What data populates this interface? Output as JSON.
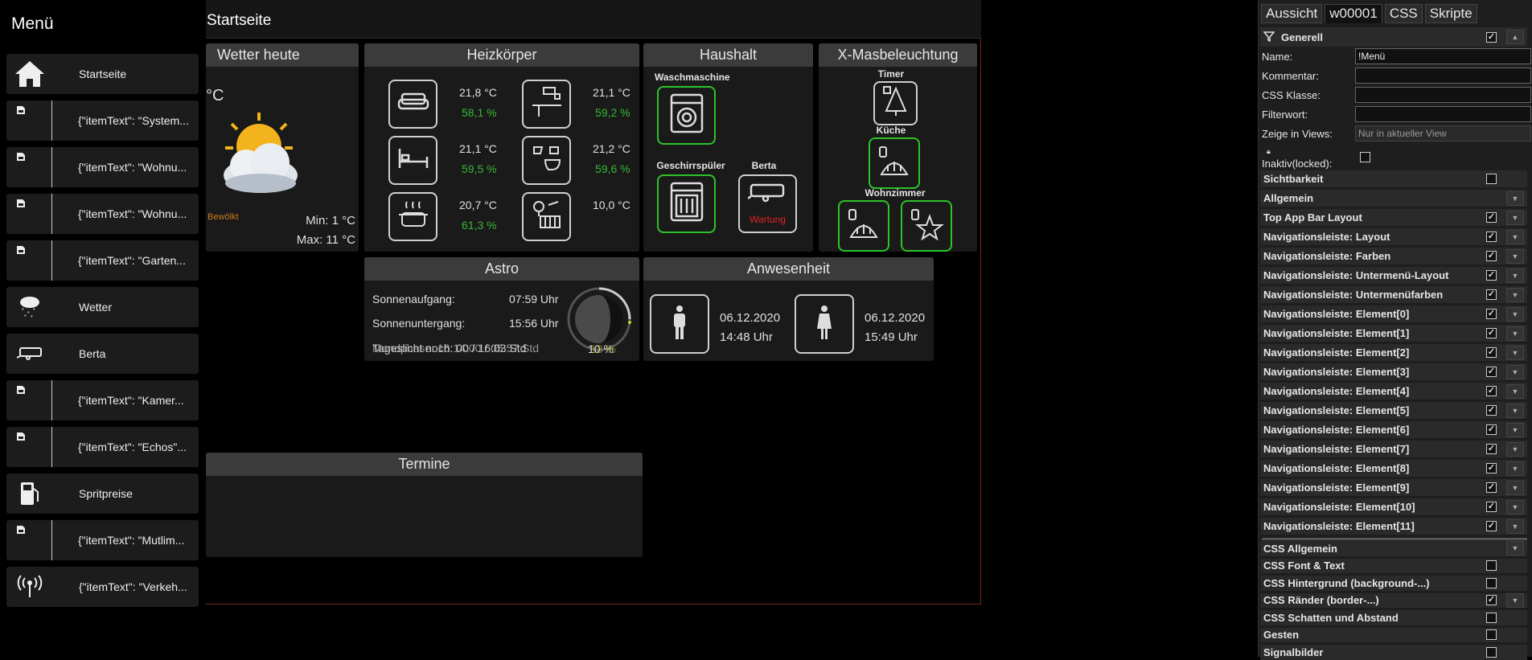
{
  "sidebar": {
    "title": "Menü",
    "items": [
      {
        "label": "Startseite",
        "icon": "home-icon"
      },
      {
        "label": "{\"itemText\": \"System...",
        "icon": "broken-image-icon"
      },
      {
        "label": "{\"itemText\": \"Wohnu...",
        "icon": "broken-image-icon"
      },
      {
        "label": "{\"itemText\": \"Wohnu...",
        "icon": "broken-image-icon"
      },
      {
        "label": "{\"itemText\": \"Garten...",
        "icon": "broken-image-icon"
      },
      {
        "label": "Wetter",
        "icon": "weather-snow-icon"
      },
      {
        "label": "Berta",
        "icon": "caravan-icon"
      },
      {
        "label": "{\"itemText\": \"Kamer...",
        "icon": "broken-image-icon"
      },
      {
        "label": "{\"itemText\": \"Echos\"...",
        "icon": "broken-image-icon"
      },
      {
        "label": "Spritpreise",
        "icon": "fuel-pump-icon"
      },
      {
        "label": "{\"itemText\": \"Mutlim...",
        "icon": "broken-image-icon"
      },
      {
        "label": "{\"itemText\": \"Verkeh...",
        "icon": "antenna-icon"
      }
    ]
  },
  "topbar": {
    "title": "Startseite"
  },
  "weather": {
    "title": "Wetter heute",
    "unit": "°C",
    "condition": "Bewölkt",
    "min": "Min: 1 °C",
    "max": "Max: 11 °C"
  },
  "heating": {
    "title": "Heizkörper",
    "rooms": [
      {
        "icon": "sofa-icon",
        "temp": "21,8 °C",
        "hum": "58,1 %"
      },
      {
        "icon": "kitchen-icon",
        "temp": "21,1 °C",
        "hum": "59,2 %"
      },
      {
        "icon": "bed-icon",
        "temp": "21,1 °C",
        "hum": "59,5 %"
      },
      {
        "icon": "bathroom-icon",
        "temp": "21,2 °C",
        "hum": "59,6 %"
      },
      {
        "icon": "cooking-pot-icon",
        "temp": "20,7 °C",
        "hum": "61,3 %"
      },
      {
        "icon": "radiator-icon",
        "temp": "10,0 °C",
        "hum": ""
      }
    ]
  },
  "household": {
    "title": "Haushalt",
    "washer": "Waschmaschine",
    "dishwasher": "Geschirrspüler",
    "caravan": "Berta",
    "caravan_status": "Wartung"
  },
  "xmas": {
    "title": "X-Masbeleuchtung",
    "timer": "Timer",
    "kitchen": "Küche",
    "living": "Wohnzimmer"
  },
  "astro": {
    "title": "Astro",
    "sunrise_label": "Sonnenaufgang:",
    "sunrise": "07:59 Uhr",
    "sunset_label": "Sonnenuntergang:",
    "sunset": "15:56 Uhr",
    "overlap_left": "Tageslicht noch: 00 / 16:03 Std",
    "overlap_right": "Mondphase: 16:14:00 / 05:57 Std",
    "moon_percent": "10 %",
    "moon_overlap": "13 %"
  },
  "presence": {
    "title": "Anwesenheit",
    "persons": [
      {
        "icon": "man-icon",
        "date": "06.12.2020",
        "time": "14:48 Uhr"
      },
      {
        "icon": "woman-icon",
        "date": "06.12.2020",
        "time": "15:49 Uhr"
      }
    ]
  },
  "appointments": {
    "title": "Termine"
  },
  "editor": {
    "tabs": [
      "Aussicht",
      "w00001",
      "CSS",
      "Skripte"
    ],
    "group_general": "Generell",
    "name_label": "Name:",
    "name_value": "!Menü",
    "comment_label": "Kommentar:",
    "css_class_label": "CSS Klasse:",
    "filter_label": "Filterwort:",
    "views_label": "Zeige in Views:",
    "views_value": "Nur in aktueller View",
    "locked_label": "Inaktiv(locked):",
    "groups": [
      {
        "label": "Sichtbarkeit",
        "checked": false,
        "arrow": false
      },
      {
        "label": "Allgemein",
        "checked": null,
        "arrow": true
      },
      {
        "label": "Top App Bar Layout",
        "checked": true,
        "arrow": true
      },
      {
        "label": "Navigationsleiste: Layout",
        "checked": true,
        "arrow": true
      },
      {
        "label": "Navigationsleiste: Farben",
        "checked": true,
        "arrow": true
      },
      {
        "label": "Navigationsleiste: Untermenü-Layout",
        "checked": true,
        "arrow": true
      },
      {
        "label": "Navigationsleiste: Untermenüfarben",
        "checked": true,
        "arrow": true
      },
      {
        "label": "Navigationsleiste: Element[0]",
        "checked": true,
        "arrow": true
      },
      {
        "label": "Navigationsleiste: Element[1]",
        "checked": true,
        "arrow": true
      },
      {
        "label": "Navigationsleiste: Element[2]",
        "checked": true,
        "arrow": true
      },
      {
        "label": "Navigationsleiste: Element[3]",
        "checked": true,
        "arrow": true
      },
      {
        "label": "Navigationsleiste: Element[4]",
        "checked": true,
        "arrow": true
      },
      {
        "label": "Navigationsleiste: Element[5]",
        "checked": true,
        "arrow": true
      },
      {
        "label": "Navigationsleiste: Element[6]",
        "checked": true,
        "arrow": true
      },
      {
        "label": "Navigationsleiste: Element[7]",
        "checked": true,
        "arrow": true
      },
      {
        "label": "Navigationsleiste: Element[8]",
        "checked": true,
        "arrow": true
      },
      {
        "label": "Navigationsleiste: Element[9]",
        "checked": true,
        "arrow": true
      },
      {
        "label": "Navigationsleiste: Element[10]",
        "checked": true,
        "arrow": true
      },
      {
        "label": "Navigationsleiste: Element[11]",
        "checked": true,
        "arrow": true
      }
    ],
    "css_groups": [
      {
        "label": "CSS Allgemein",
        "checked": null,
        "arrow": true
      },
      {
        "label": "CSS Font & Text",
        "checked": false,
        "arrow": false
      },
      {
        "label": "CSS Hintergrund (background-...)",
        "checked": false,
        "arrow": false
      },
      {
        "label": "CSS Ränder (border-...)",
        "checked": true,
        "arrow": true
      },
      {
        "label": "CSS Schatten und Abstand",
        "checked": false,
        "arrow": false
      },
      {
        "label": "Gesten",
        "checked": false,
        "arrow": false
      },
      {
        "label": "Signalbilder",
        "checked": false,
        "arrow": false
      }
    ]
  }
}
